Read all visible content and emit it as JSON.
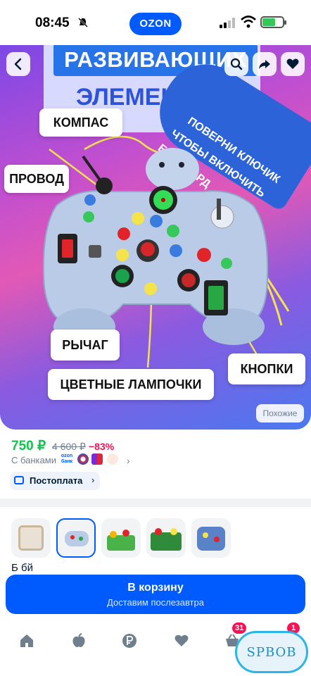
{
  "status_bar": {
    "time": "08:45",
    "app_pill": "OZON"
  },
  "hero": {
    "title_line1": "РАЗВИВАЮЩИХ",
    "title_line2": "ЭЛЕМЕНТОВ",
    "callouts": {
      "compass": "КОМПАС",
      "wire": "ПРОВОД",
      "lever": "РЫЧАГ",
      "lamps": "ЦВЕТНЫЕ ЛАМПОЧКИ",
      "buttons": "КНОПКИ"
    },
    "banner_lines": [
      "ПОВЕРНИ КЛЮЧИК",
      "ЧТОБЫ ВКЛЮЧИТЬ",
      "БИЗИБОРД"
    ],
    "similar_label": "Похожие",
    "icons": [
      "back-arrow-icon",
      "search-icon",
      "share-icon",
      "heart-icon"
    ]
  },
  "price": {
    "current": "750 ₽",
    "old": "4 600 ₽",
    "discount": "−83%",
    "banks_label": "С банками",
    "ozon_bank_label": "ozon банк"
  },
  "postpay": {
    "label": "Постоплата"
  },
  "description_peek": "Б       бй",
  "cart": {
    "label": "В корзину",
    "sublabel": "Доставим послезавтра"
  },
  "bottom_nav": {
    "items": [
      "home-icon",
      "fresh-apple-icon",
      "ruble-icon",
      "favorites-heart-icon",
      "cart-basket-icon",
      "profile-icon"
    ],
    "cart_badge": "31",
    "profile_badge": "1"
  },
  "watermark": "SPBOB",
  "colors": {
    "brand_blue": "#005bff",
    "price_green": "#10c44c",
    "discount_pink": "#f91155"
  }
}
